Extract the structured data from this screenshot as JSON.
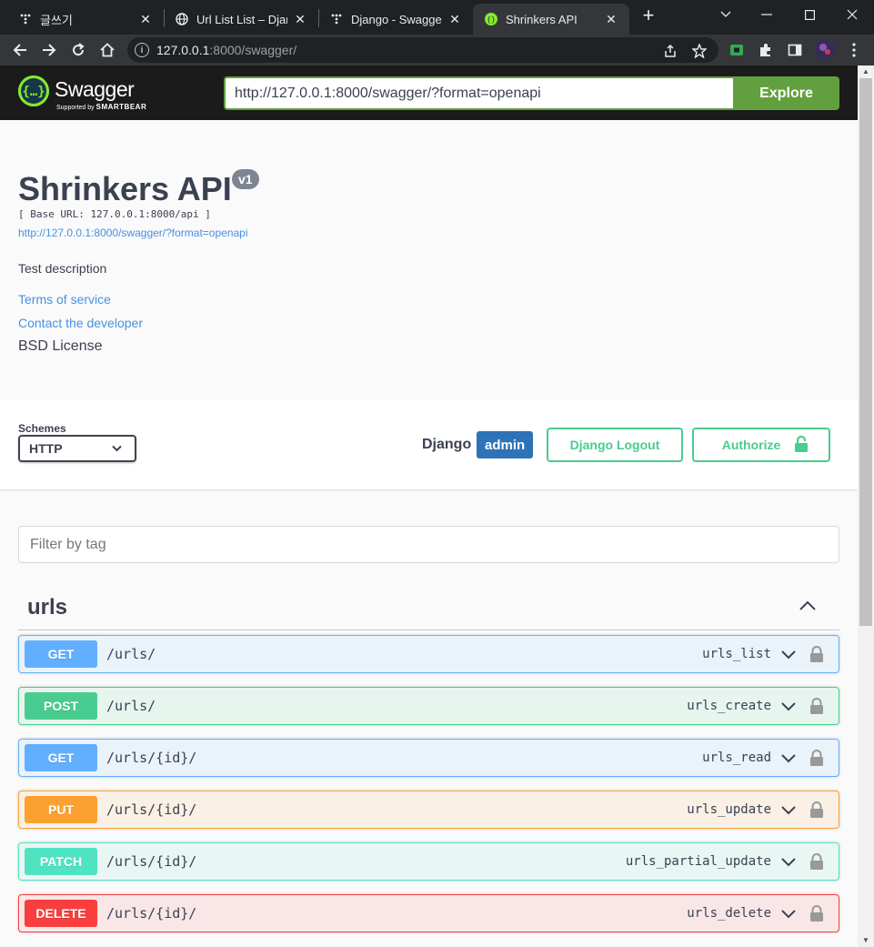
{
  "browser": {
    "tabs": [
      {
        "title": "글쓰기",
        "close": "✕"
      },
      {
        "title": "Url List List – Djang",
        "close": "✕"
      },
      {
        "title": "Django - Swagger",
        "close": "✕"
      },
      {
        "title": "Shrinkers API",
        "close": "✕"
      }
    ],
    "new_tab": "+",
    "url_host": "127.0.0.1",
    "url_path": ":8000/swagger/"
  },
  "topbar": {
    "brand": "Swagger",
    "sub_prefix": "Supported by",
    "sub_brand": "SMARTBEAR",
    "spec_url": "http://127.0.0.1:8000/swagger/?format=openapi",
    "explore": "Explore"
  },
  "info": {
    "title": "Shrinkers API",
    "version": "v1",
    "base_url": "[ Base URL: 127.0.0.1:8000/api ]",
    "spec_link": "http://127.0.0.1:8000/swagger/?format=openapi",
    "description": "Test description",
    "terms": "Terms of service",
    "contact": "Contact the developer",
    "license": "BSD License"
  },
  "schemes": {
    "label": "Schemes",
    "selected": "HTTP",
    "django_label": "Django",
    "user": "admin",
    "logout": "Django Logout",
    "authorize": "Authorize"
  },
  "filter": {
    "placeholder": "Filter by tag"
  },
  "tag": {
    "name": "urls"
  },
  "operations": [
    {
      "method": "GET",
      "path": "/urls/",
      "op_id": "urls_list"
    },
    {
      "method": "POST",
      "path": "/urls/",
      "op_id": "urls_create"
    },
    {
      "method": "GET",
      "path": "/urls/{id}/",
      "op_id": "urls_read"
    },
    {
      "method": "PUT",
      "path": "/urls/{id}/",
      "op_id": "urls_update"
    },
    {
      "method": "PATCH",
      "path": "/urls/{id}/",
      "op_id": "urls_partial_update"
    },
    {
      "method": "DELETE",
      "path": "/urls/{id}/",
      "op_id": "urls_delete"
    }
  ],
  "colors": {
    "get": "#61affe",
    "post": "#49cc90",
    "put": "#fca130",
    "patch": "#50e3c2",
    "delete": "#f93e3e",
    "explore": "#62a03f",
    "admin_badge": "#2e72b7"
  }
}
